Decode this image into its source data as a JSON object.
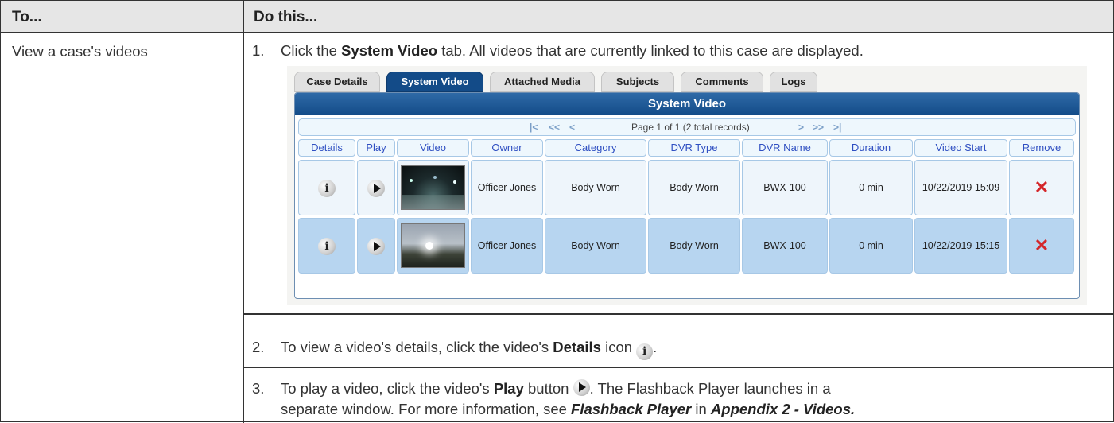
{
  "table": {
    "header": {
      "col1": "To...",
      "col2": "Do this..."
    },
    "task": "View a case's videos",
    "steps": [
      {
        "num": "1.",
        "pre": "Click the ",
        "bold": "System Video",
        "post": " tab. All videos that are currently linked to this case are displayed."
      },
      {
        "num": "2.",
        "pre": "To view a video's details, click the video's ",
        "bold": "Details",
        "post": " icon",
        "post2": "."
      },
      {
        "num": "3.",
        "pre": "To play a video, click the video's ",
        "bold": "Play",
        "post": " button",
        "post2": ". The Flashback Player launches in a",
        "line2_pre": "separate window. For more information, see ",
        "ref1": "Flashback Player",
        "line2_mid": " in ",
        "ref2": "Appendix 2 - Videos."
      }
    ]
  },
  "screenshot": {
    "tabs": [
      "Case Details",
      "System Video",
      "Attached Media",
      "Subjects",
      "Comments",
      "Logs"
    ],
    "active_tab": "System Video",
    "panel_title": "System Video",
    "pager": {
      "first": "|<",
      "prev_page": "<<",
      "prev": "<",
      "label": "Page 1 of 1 (2 total records)",
      "next": ">",
      "next_page": ">>",
      "last": ">|"
    },
    "columns": [
      "Details",
      "Play",
      "Video",
      "Owner",
      "Category",
      "DVR Type",
      "DVR Name",
      "Duration",
      "Video Start",
      "Remove"
    ],
    "rows": [
      {
        "owner": "Officer Jones",
        "category": "Body Worn",
        "dvr_type": "Body Worn",
        "dvr_name": "BWX-100",
        "duration": "0 min",
        "video_start": "10/22/2019 15:09"
      },
      {
        "owner": "Officer Jones",
        "category": "Body Worn",
        "dvr_type": "Body Worn",
        "dvr_name": "BWX-100",
        "duration": "0 min",
        "video_start": "10/22/2019 15:15"
      }
    ],
    "icons": {
      "details": "info-icon",
      "play": "play-icon",
      "remove": "remove-x-icon"
    },
    "colors": {
      "active_tab": "#134b88",
      "header_text": "#2f4fc2",
      "selected_row": "#b7d5f0",
      "remove": "#d4262a"
    }
  }
}
